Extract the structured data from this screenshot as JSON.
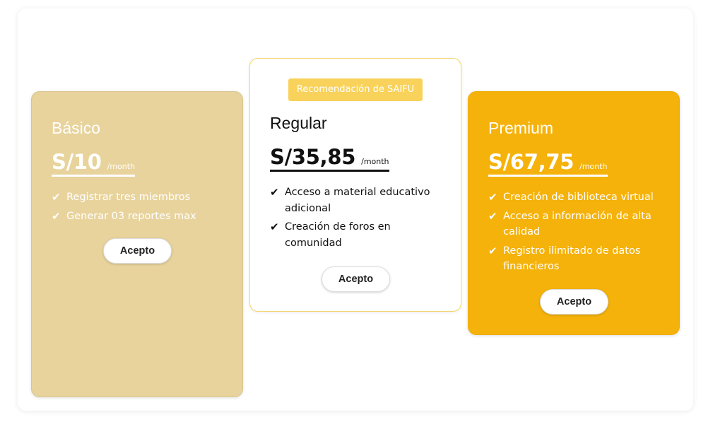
{
  "plans": {
    "basic": {
      "name": "Básico",
      "price": "S/10",
      "period": "/month",
      "features": [
        "Registrar tres miembros",
        "Generar 03 reportes max"
      ],
      "button": "Acepto",
      "color": "#e8d39c"
    },
    "regular": {
      "badge": "Recomendación de SAIFU",
      "name": "Regular",
      "price": "S/35,85",
      "period": "/month",
      "features": [
        "Acceso a material educativo adicional",
        "Creación de foros en comunidad"
      ],
      "button": "Acepto",
      "color": "#ffffff",
      "badge_color": "#f8d25a"
    },
    "premium": {
      "name": "Premium",
      "price": "S/67,75",
      "period": "/month",
      "features": [
        "Creación de biblioteca virtual",
        "Acceso a información de alta calidad",
        "Registro ilimitado de datos financieros"
      ],
      "button": "Acepto",
      "color": "#f5b20a"
    }
  },
  "icons": {
    "feature_check": "checkmark-icon"
  }
}
